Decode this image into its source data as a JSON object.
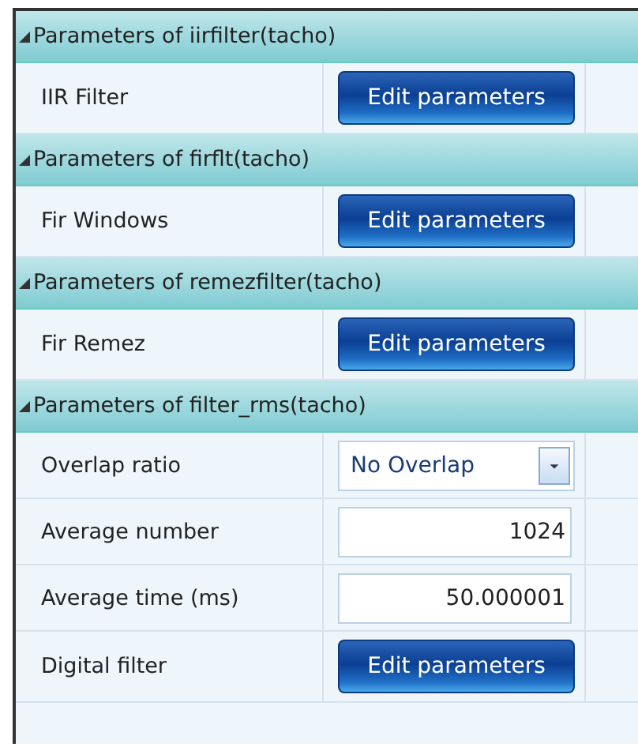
{
  "sections": [
    {
      "title": "Parameters of iirfilter(tacho)",
      "expanded": true,
      "rows": [
        {
          "kind": "button",
          "label": "IIR Filter",
          "value": "Edit parameters"
        }
      ]
    },
    {
      "title": "Parameters of firflt(tacho)",
      "expanded": true,
      "rows": [
        {
          "kind": "button",
          "label": "Fir Windows",
          "value": "Edit parameters"
        }
      ]
    },
    {
      "title": "Parameters of remezfilter(tacho)",
      "expanded": true,
      "rows": [
        {
          "kind": "button",
          "label": "Fir Remez",
          "value": "Edit parameters"
        }
      ]
    },
    {
      "title": "Parameters of filter_rms(tacho)",
      "expanded": true,
      "rows": [
        {
          "kind": "dropdown",
          "label": "Overlap ratio",
          "value": "No Overlap"
        },
        {
          "kind": "number",
          "label": "Average number",
          "value": "1024"
        },
        {
          "kind": "number",
          "label": "Average time (ms)",
          "value": "50.000001"
        },
        {
          "kind": "button",
          "label": "Digital filter",
          "value": "Edit parameters"
        }
      ]
    }
  ]
}
